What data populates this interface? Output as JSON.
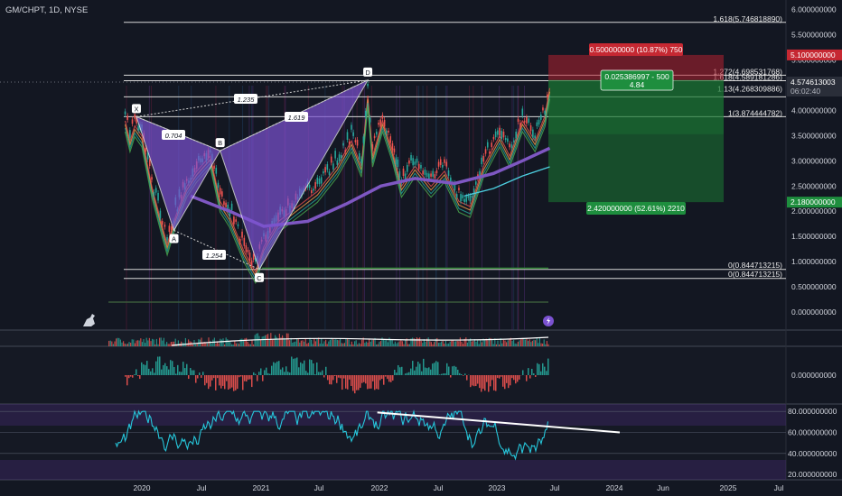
{
  "header": {
    "symbol": "GM/CHPT, 1D, NYSE"
  },
  "chart_data": {
    "type": "line",
    "x_ticks": [
      "2020",
      "Jul",
      "2021",
      "Jul",
      "2022",
      "Jul",
      "2023",
      "Jul",
      "2024",
      "Jun",
      "2025",
      "Jul"
    ],
    "y_ticks": [
      "6.000000000",
      "5.500000000",
      "5.000000000",
      "4.500000000",
      "4.000000000",
      "3.500000000",
      "3.000000000",
      "2.500000000",
      "2.000000000",
      "1.500000000",
      "1.000000000",
      "0.500000000",
      "0.000000000"
    ],
    "ylim": [
      -0.1,
      6.15
    ],
    "price_series": [
      [
        "2019-11-10",
        3.9
      ],
      [
        "2019-11-25",
        3.5
      ],
      [
        "2019-12-10",
        3.8
      ],
      [
        "2020-01-01",
        3.6
      ],
      [
        "2020-02-01",
        2.6
      ],
      [
        "2020-03-05",
        1.8
      ],
      [
        "2020-03-20",
        1.45
      ],
      [
        "2020-04-15",
        2.0
      ],
      [
        "2020-05-20",
        2.6
      ],
      [
        "2020-06-20",
        2.9
      ],
      [
        "2020-08-01",
        3.2
      ],
      [
        "2020-09-01",
        2.3
      ],
      [
        "2020-10-01",
        2.0
      ],
      [
        "2020-11-15",
        1.3
      ],
      [
        "2020-12-20",
        0.9
      ],
      [
        "2021-01-15",
        1.4
      ],
      [
        "2021-03-01",
        1.9
      ],
      [
        "2021-05-01",
        2.2
      ],
      [
        "2021-07-01",
        2.5
      ],
      [
        "2021-09-01",
        3.0
      ],
      [
        "2021-10-15",
        3.5
      ],
      [
        "2021-11-15",
        3.0
      ],
      [
        "2021-12-05",
        4.4
      ],
      [
        "2021-12-20",
        3.2
      ],
      [
        "2022-01-20",
        3.9
      ],
      [
        "2022-02-20",
        3.3
      ],
      [
        "2022-03-20",
        2.6
      ],
      [
        "2022-05-01",
        3.0
      ],
      [
        "2022-06-20",
        2.6
      ],
      [
        "2022-08-01",
        2.9
      ],
      [
        "2022-09-15",
        2.3
      ],
      [
        "2022-10-20",
        2.2
      ],
      [
        "2022-12-01",
        3.0
      ],
      [
        "2023-01-20",
        3.6
      ],
      [
        "2023-02-20",
        3.2
      ],
      [
        "2023-04-01",
        3.9
      ],
      [
        "2023-05-10",
        3.5
      ],
      [
        "2023-06-10",
        4.0
      ],
      [
        "2023-06-25",
        4.55
      ]
    ],
    "ma_slow": [
      [
        "2020-06-01",
        2.3
      ],
      [
        "2020-10-01",
        2.0
      ],
      [
        "2021-01-15",
        1.7
      ],
      [
        "2021-06-01",
        1.8
      ],
      [
        "2021-10-01",
        2.15
      ],
      [
        "2022-01-15",
        2.5
      ],
      [
        "2022-05-01",
        2.65
      ],
      [
        "2022-09-01",
        2.55
      ],
      [
        "2023-01-01",
        2.75
      ],
      [
        "2023-04-01",
        3.0
      ],
      [
        "2023-06-25",
        3.25
      ]
    ],
    "ma_cyan": [
      [
        "2022-10-01",
        2.3
      ],
      [
        "2023-01-01",
        2.45
      ],
      [
        "2023-04-01",
        2.7
      ],
      [
        "2023-06-25",
        2.88
      ]
    ],
    "pattern": {
      "points": [
        {
          "label": "X",
          "date": "2019-12-15",
          "value": 3.874444782
        },
        {
          "label": "A",
          "date": "2020-04-10",
          "value": 1.62
        },
        {
          "label": "B",
          "date": "2020-09-01",
          "value": 3.2
        },
        {
          "label": "C",
          "date": "2021-01-01",
          "value": 0.844713215
        },
        {
          "label": "D",
          "date": "2021-12-05",
          "value": 4.6
        }
      ],
      "ratios": [
        "0.704",
        "1.235",
        "1.254",
        "1.619"
      ]
    },
    "fib_levels": [
      {
        "label": "1.618(5.746818890)",
        "value": 5.74681889
      },
      {
        "label": "1.272(4.698531768)",
        "value": 4.698531768
      },
      {
        "label": "1.618(4.589181286)",
        "value": 4.589181286
      },
      {
        "label": "1.13(4.268309886)",
        "value": 4.268309886
      },
      {
        "label": "1(3.874444782)",
        "value": 3.874444782
      },
      {
        "label": "0(0.844713215)",
        "value": 0.844713215
      },
      {
        "label": "0(0.844713215)",
        "value": 0.844713215
      }
    ],
    "position": {
      "target_label": "0.500000000 (10.87%) 750",
      "stop_label": "2.420000000 (52.61%) 2210",
      "entry_label_1": "0.025386997 - 500",
      "entry_label_2": "4.84",
      "target_price": 5.1,
      "stop_price": 2.18,
      "entry_price": 4.6
    },
    "price_tags": {
      "target": "5.100000000",
      "stop": "2.180000000",
      "last": "4.574613003",
      "countdown": "06:02:40"
    },
    "macd_axis_label": "0.000000000",
    "rsi": {
      "y_ticks": [
        "80.000000000",
        "60.000000000",
        "40.000000000",
        "20.000000000"
      ],
      "trendline": [
        [
          "2022-03-01",
          79
        ],
        [
          "2024-01-01",
          60
        ]
      ]
    }
  },
  "colors": {
    "background": "#131722",
    "pattern_fill": "#7b52d1",
    "up": "#26a69a",
    "down": "#ef5350",
    "target_red": "#b2202f",
    "stop_green": "#1b7a33"
  }
}
